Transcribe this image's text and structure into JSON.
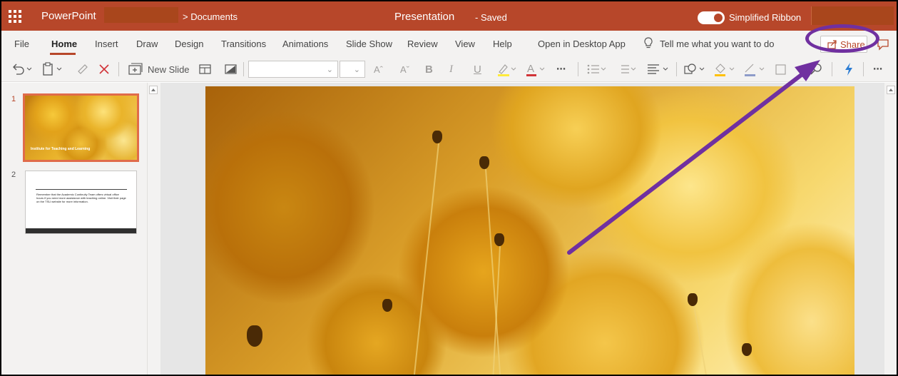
{
  "titlebar": {
    "app_name": "PowerPoint",
    "breadcrumb": "> Documents",
    "doc_title": "Presentation",
    "doc_status": "-  Saved",
    "simplified_ribbon": "Simplified Ribbon"
  },
  "tabs": {
    "file": "File",
    "home": "Home",
    "insert": "Insert",
    "draw": "Draw",
    "design": "Design",
    "transitions": "Transitions",
    "animations": "Animations",
    "slide_show": "Slide Show",
    "review": "Review",
    "view": "View",
    "help": "Help",
    "open_desktop": "Open in Desktop App",
    "tell_me": "Tell me what you want to do",
    "share": "Share"
  },
  "toolbar": {
    "new_slide": "New Slide",
    "more": "⋯",
    "font_grow": "Aˆ",
    "font_shrink": "Aˇ",
    "bold": "B",
    "italic": "I",
    "underline": "U"
  },
  "thumbnails": [
    {
      "number": "1",
      "caption": "Institute for Teaching and Learning"
    },
    {
      "number": "2",
      "text": "Remember that the Academic Continuity Team offers virtual office hours if you need more assistance with teaching online. Visit their page on the TSU website for more information."
    }
  ],
  "colors": {
    "brand": "#b7472a",
    "annotation": "#7030a0"
  }
}
